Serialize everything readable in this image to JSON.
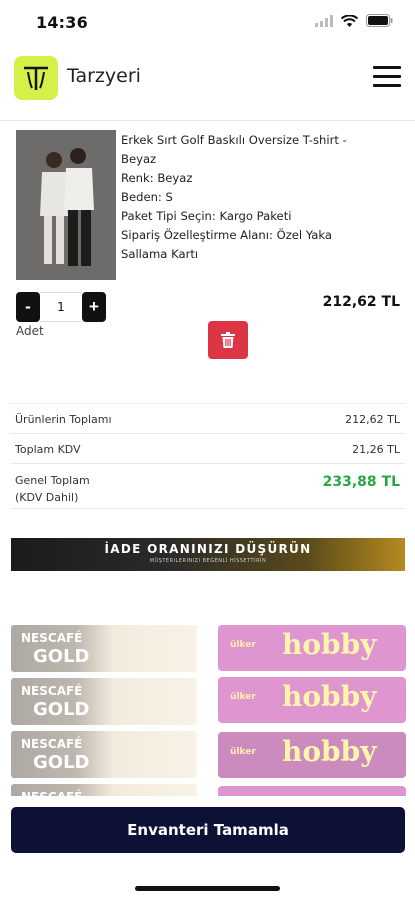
{
  "status": {
    "time": "14:36"
  },
  "header": {
    "brand": "Tarzyeri"
  },
  "cart_item": {
    "lines": [
      "Erkek Sırt Golf Baskılı Oversize T-shirt -",
      "Beyaz",
      "Renk: Beyaz",
      "Beden: S",
      "Paket Tipi Seçin: Kargo Paketi",
      "Sipariş Özelleştirme Alanı: Özel Yaka",
      "Sallama Kartı"
    ],
    "quantity": "1",
    "minus": "-",
    "plus": "+",
    "quantity_label": "Adet",
    "price": "212,62 TL"
  },
  "summary": {
    "subtotal_label": "Ürünlerin Toplamı",
    "subtotal_value": "212,62 TL",
    "vat_label": "Toplam KDV",
    "vat_value": "21,26 TL",
    "total_label_1": "Genel Toplam",
    "total_label_2": "(KDV Dahil)",
    "total_value": "233,88 TL",
    "total_color": "#28a745"
  },
  "banner": {
    "title": "İADE ORANINIZI DÜŞÜRÜN",
    "subtitle": "MÜŞTERILERINIZI BEĞENLİ HİSSETTİRİN"
  },
  "promo_products": {
    "left_line1": "NESCAFÉ",
    "left_line2": "GOLD",
    "right_brand": "ülker",
    "right_name": "hobby"
  },
  "footer": {
    "complete_button": "Envanteri Tamamla"
  },
  "colors": {
    "logo_bg": "#d6f04a",
    "delete": "#dc3545",
    "primary_button": "#0d1136"
  }
}
